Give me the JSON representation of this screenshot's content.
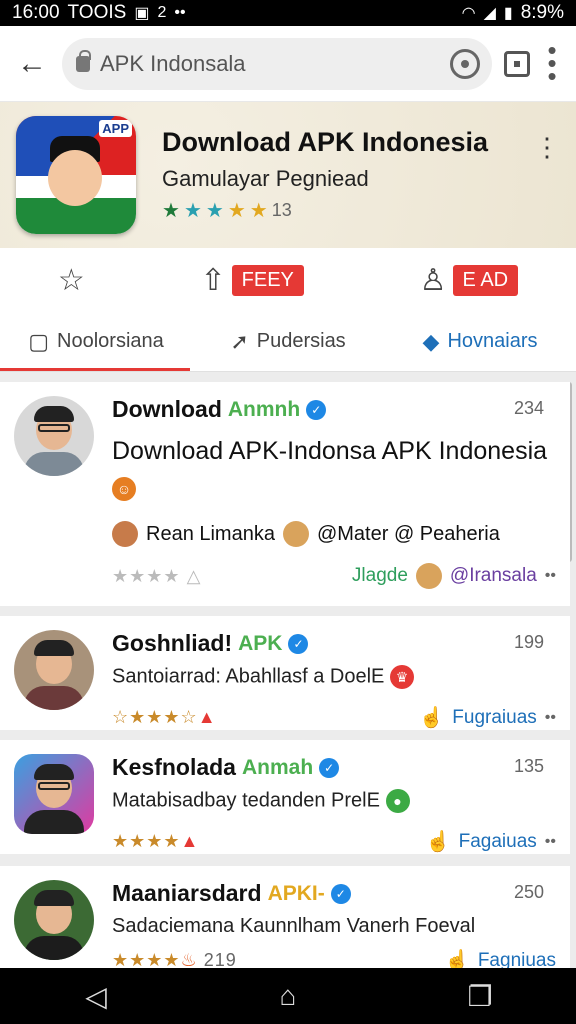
{
  "status_bar": {
    "time": "16:00",
    "tag": "TOOIS",
    "battery": "8:9%"
  },
  "browser": {
    "url": "APK Indonsala"
  },
  "app": {
    "title": "Download APK Indonesia",
    "subtitle": "Gamulayar Pegniead",
    "rating_count": "13",
    "icon_tag": "APP"
  },
  "actions": {
    "badge1": "FEEY",
    "badge2": "E AD"
  },
  "tabs": [
    {
      "label": "Noolorsiana"
    },
    {
      "label": "Pudersias"
    },
    {
      "label": "Hovnaiars"
    }
  ],
  "cards": [
    {
      "name": "Download",
      "green": "Anmnh",
      "count": "234",
      "headline": "Download APK-Indonsa APK Indonesia",
      "people1": "Rean Limanka",
      "people2": "@Mater @ Peaheria",
      "link1": "Jlagde",
      "link2": "@Iransala",
      "stars": 4
    },
    {
      "name": "Goshnliad!",
      "green": "APK",
      "count": "199",
      "text": "Santoiarrad: Abahllasf a DoelE",
      "link": "Fugraiuas",
      "stars": 4
    },
    {
      "name": "Kesfnolada",
      "green": "Anmah",
      "count": "135",
      "text": "Matabisadbay tedanden PrelE",
      "link": "Fagaiuas",
      "stars": 4
    },
    {
      "name": "Maaniarsdard",
      "green": "APKI-",
      "count": "250",
      "text": "Sadaciemana Kaunnlham Vanerh Foeval",
      "rating": "219",
      "link": "Fagniuas",
      "stars": 4
    }
  ]
}
